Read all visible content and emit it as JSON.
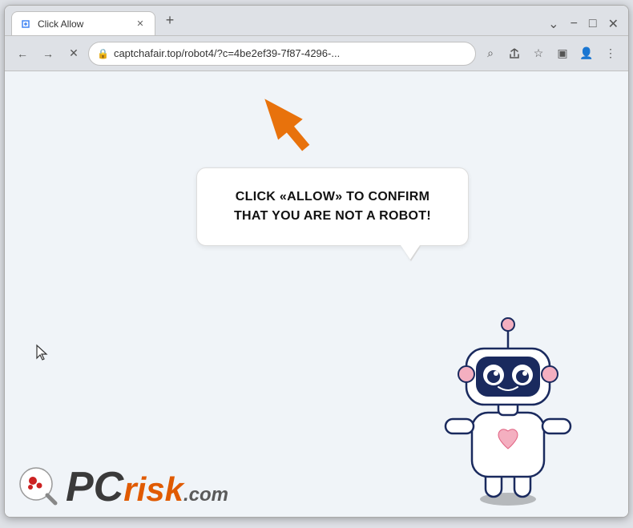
{
  "browser": {
    "tab": {
      "title": "Click Allow",
      "favicon": "page-icon"
    },
    "controls": {
      "minimize": "−",
      "maximize": "□",
      "close": "✕",
      "chevron_down": "⌄"
    },
    "nav": {
      "back_label": "←",
      "forward_label": "→",
      "reload_label": "✕",
      "address": "captchafair.top/robot4/?c=4be2ef39-7f87-4296-...",
      "lock_icon": "🔒",
      "search_icon": "⌕",
      "share_icon": "↑",
      "star_icon": "☆",
      "sidebar_icon": "▣",
      "profile_icon": "👤",
      "menu_icon": "⋮",
      "new_tab_label": "+"
    },
    "page": {
      "bubble_text": "CLICK «ALLOW» TO CONFIRM THAT YOU ARE NOT A ROBOT!",
      "pcrisk_text": "PCrisk.com"
    }
  }
}
